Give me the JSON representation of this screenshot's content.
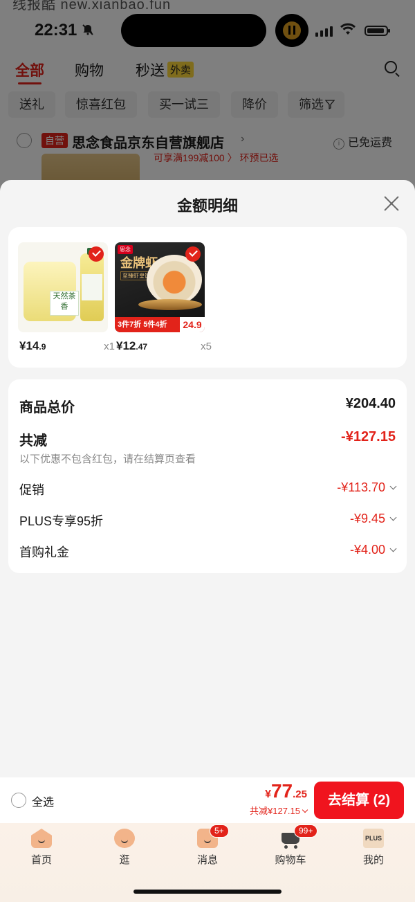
{
  "watermark": "线报酷 new.xianbao.fun",
  "status_bar": {
    "time": "22:31"
  },
  "top_tabs": [
    {
      "label": "全部"
    },
    {
      "label": "购物"
    },
    {
      "label": "秒送",
      "badge": "外卖"
    }
  ],
  "filter_chips": [
    "送礼",
    "惊喜红包",
    "买一试三",
    "降价",
    "筛选"
  ],
  "store": {
    "tag": "自营",
    "name": "思念食品京东自营旗舰店",
    "shipping": "已免运费",
    "promo_snippet": "可享满199减100 〉  环预已选"
  },
  "sheet": {
    "title": "金额明细",
    "products": [
      {
        "price_int": "¥14",
        "price_dec": ".9",
        "qty": "x1",
        "image_text": "天然茶香"
      },
      {
        "price_int": "¥12",
        "price_dec": ".47",
        "qty": "x5",
        "image_title": "金牌虾",
        "image_sub": "至臻虾皇饺",
        "image_logo": "思念",
        "image_promo": "3件7折 5件4折",
        "image_price": "24.9"
      }
    ],
    "summary": {
      "goods_total_label": "商品总价",
      "goods_total_value": "¥204.40",
      "reduction_label": "共减",
      "reduction_value": "-¥127.15",
      "note": "以下优惠不包含红包，请在结算页查看",
      "items": [
        {
          "label": "促销",
          "value": "-¥113.70"
        },
        {
          "label": "PLUS专享95折",
          "value": "-¥9.45"
        },
        {
          "label": "首购礼金",
          "value": "-¥4.00"
        }
      ]
    }
  },
  "checkout": {
    "select_all": "全选",
    "currency": "¥",
    "total_int": "77",
    "total_dec": ".25",
    "discount": "共减¥127.15",
    "button": "去结算 (2)"
  },
  "tabbar": [
    {
      "label": "首页"
    },
    {
      "label": "逛"
    },
    {
      "label": "消息",
      "badge": "5+"
    },
    {
      "label": "购物车",
      "badge": "99+"
    },
    {
      "label": "我的",
      "icon_text": "PLUS"
    }
  ],
  "colors": {
    "accent": "#e2231a",
    "checkout_button": "#f0141e"
  }
}
